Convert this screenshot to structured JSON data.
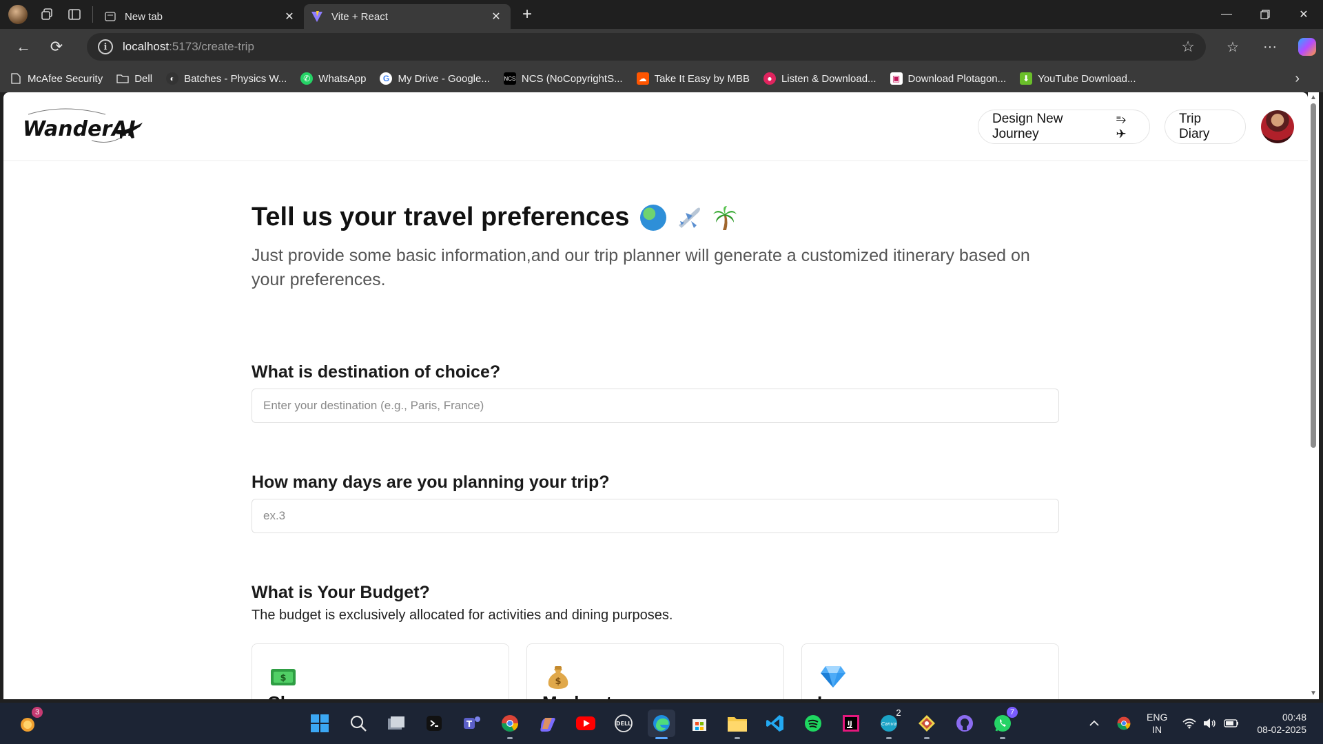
{
  "browser": {
    "tabs": [
      {
        "title": "New tab"
      },
      {
        "title": "Vite + React"
      }
    ],
    "url_host": "localhost",
    "url_path": ":5173/create-trip",
    "bookmarks": [
      {
        "label": "McAfee Security",
        "icon": "page-icon"
      },
      {
        "label": "Dell",
        "icon": "folder-icon"
      },
      {
        "label": "Batches - Physics W...",
        "icon": "pw-icon"
      },
      {
        "label": "WhatsApp",
        "icon": "whatsapp-icon"
      },
      {
        "label": "My Drive - Google...",
        "icon": "google-icon"
      },
      {
        "label": "NCS (NoCopyrightS...",
        "icon": "ncs-icon"
      },
      {
        "label": "Take It Easy by MBB",
        "icon": "soundcloud-icon"
      },
      {
        "label": "Listen & Download...",
        "icon": "music-icon"
      },
      {
        "label": "Download Plotagon...",
        "icon": "plotagon-icon"
      },
      {
        "label": "YouTube Download...",
        "icon": "download-icon"
      }
    ]
  },
  "app": {
    "logo_text": "WanderAI",
    "nav": {
      "design_label": "Design New Journey",
      "diary_label": "Trip Diary"
    }
  },
  "form": {
    "title": "Tell us your travel preferences",
    "subtitle": "Just provide some basic information,and our trip planner will generate a customized itinerary based on your preferences.",
    "destination": {
      "question": "What is destination of choice?",
      "placeholder": "Enter your destination (e.g., Paris, France)"
    },
    "days": {
      "question": "How many days are you planning your trip?",
      "placeholder": "ex.3"
    },
    "budget": {
      "question": "What is Your Budget?",
      "description": "The budget is exclusively allocated for activities and dining purposes.",
      "options": [
        {
          "title": "Cheap",
          "icon": "cash-icon"
        },
        {
          "title": "Moderate",
          "icon": "money-bag-icon"
        },
        {
          "title": "Luxury",
          "icon": "diamond-icon"
        }
      ]
    }
  },
  "taskbar": {
    "notif_badge": "3",
    "canva_badge": "2",
    "whatsapp_badge": "7",
    "lang_line1": "ENG",
    "lang_line2": "IN",
    "time": "00:48",
    "date": "08-02-2025"
  }
}
